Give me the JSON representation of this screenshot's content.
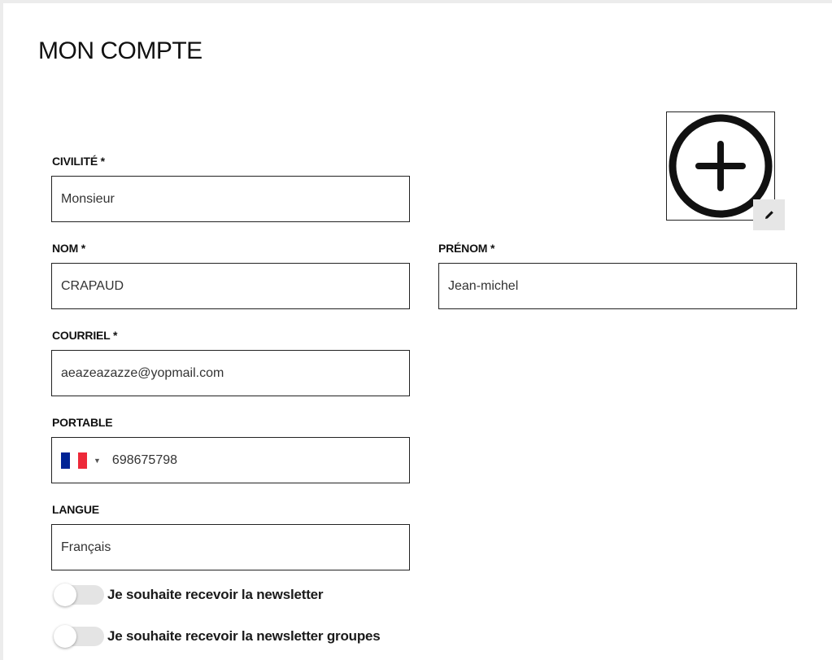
{
  "page": {
    "title": "MON COMPTE"
  },
  "form": {
    "civilite": {
      "label": "CIVILITÉ *",
      "value": "Monsieur"
    },
    "nom": {
      "label": "NOM *",
      "value": "CRAPAUD"
    },
    "prenom": {
      "label": "PRÉNOM *",
      "value": "Jean-michel"
    },
    "courriel": {
      "label": "COURRIEL *",
      "value": "aeazeazazze@yopmail.com"
    },
    "portable": {
      "label": "PORTABLE",
      "value": "698675798",
      "country_flag_icon": "france-flag-icon",
      "flag_colors": [
        "#002395",
        "#ffffff",
        "#ed2939"
      ]
    },
    "langue": {
      "label": "LANGUE",
      "value": "Français"
    }
  },
  "avatar": {
    "icon": "add-circle-icon",
    "edit_icon": "pencil-icon"
  },
  "toggles": [
    {
      "label": "Je souhaite recevoir la newsletter",
      "checked": false
    },
    {
      "label": "Je souhaite recevoir la newsletter groupes",
      "checked": false
    }
  ]
}
